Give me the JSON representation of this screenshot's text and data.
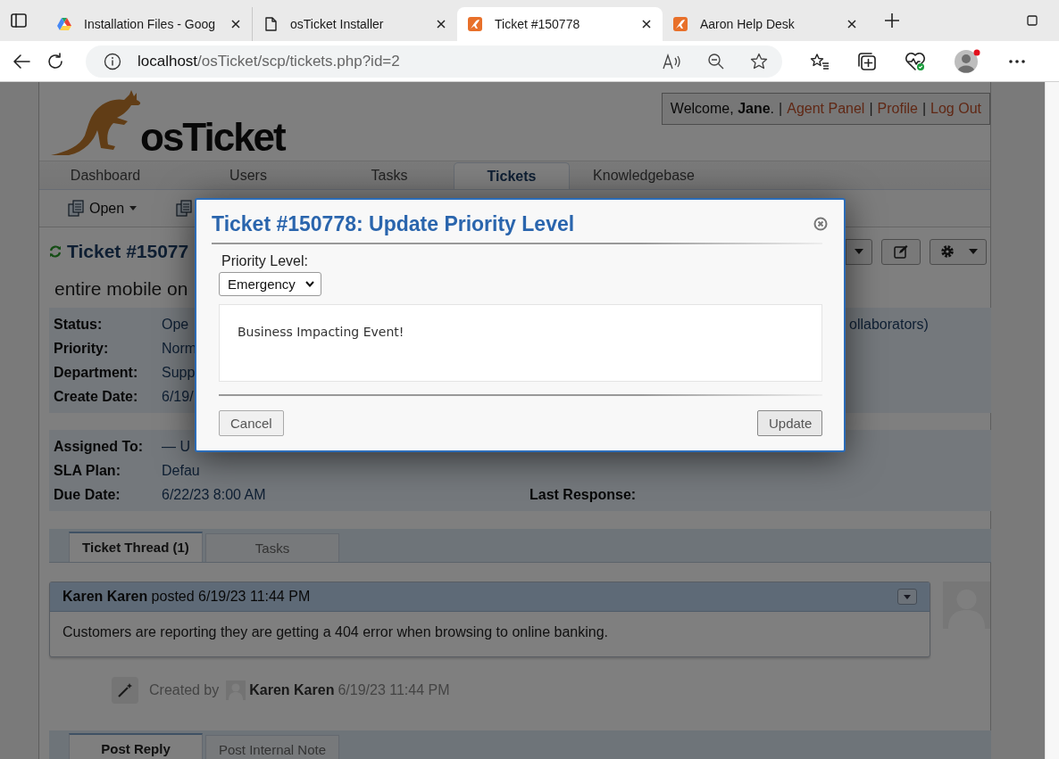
{
  "browser": {
    "tabs": [
      {
        "title": "Installation Files - Goog",
        "kind": "drive",
        "selected": false
      },
      {
        "title": "osTicket Installer",
        "kind": "page",
        "selected": false
      },
      {
        "title": "Ticket #150778",
        "kind": "app",
        "selected": true
      },
      {
        "title": "Aaron Help Desk",
        "kind": "app",
        "selected": false
      }
    ],
    "address": {
      "host": "localhost",
      "path": "/osTicket/scp/tickets.php?id=2"
    }
  },
  "header": {
    "logo": "osTicket",
    "welcome": "Welcome, **Jane**.",
    "links": [
      {
        "separator": "|",
        "label": "Agent Panel"
      },
      {
        "separator": "|",
        "label": "Profile"
      },
      {
        "separator": "|",
        "label": "Log Out"
      }
    ]
  },
  "nav": [
    {
      "label": "Dashboard",
      "selected": false
    },
    {
      "label": "Users",
      "selected": false
    },
    {
      "label": "Tasks",
      "selected": false
    },
    {
      "label": "Tickets",
      "selected": true
    },
    {
      "label": "Knowledgebase",
      "selected": false
    }
  ],
  "subnav": [
    {
      "kind": "menu",
      "label": "Open"
    },
    {
      "kind": "icon"
    }
  ],
  "ticket": {
    "title": "Ticket #15077",
    "subject": "entire mobile on",
    "toolbar": [
      {
        "kind": "dropdown"
      },
      {
        "kind": "edit"
      },
      {
        "kind": "settings"
      }
    ],
    "info_1": [
      {
        "label": "Status:",
        "value": "Ope",
        "right_value": "ollaborators)"
      },
      {
        "label": "Priority:",
        "value": "Norm"
      },
      {
        "label": "Department:",
        "value": "Supp"
      },
      {
        "label": "Create Date:",
        "value": "6/19/"
      }
    ],
    "info_2": [
      {
        "label": "Assigned To:",
        "value": "— U"
      },
      {
        "label": "SLA Plan:",
        "value": "Defau"
      },
      {
        "label": "Due Date:",
        "value": "6/22/23 8:00 AM",
        "right_label": "Last Response:"
      }
    ]
  },
  "thread_tabs": [
    {
      "label": "Ticket Thread (1)",
      "selected": true
    },
    {
      "label": "Tasks",
      "selected": false
    }
  ],
  "thread": {
    "header": "**Karen Karen** posted 6/19/23 11:44 PM",
    "body": "Customers are reporting they are getting a 404 error when browsing to online banking.",
    "event": {
      "prefix": "Created by",
      "user": "Karen Karen",
      "time": "6/19/23 11:44 PM"
    }
  },
  "reply_tabs": [
    {
      "label": "Post Reply",
      "selected": true
    },
    {
      "label": "Post Internal Note",
      "selected": false
    }
  ],
  "modal": {
    "title": "Ticket #150778: Update Priority Level",
    "field_label": "Priority Level:",
    "select_value": "Emergency",
    "note": "Business Impacting Event!",
    "buttons": [
      {
        "kind": "cancel",
        "label": "Cancel"
      },
      {
        "kind": "primary",
        "label": "Update"
      }
    ]
  }
}
